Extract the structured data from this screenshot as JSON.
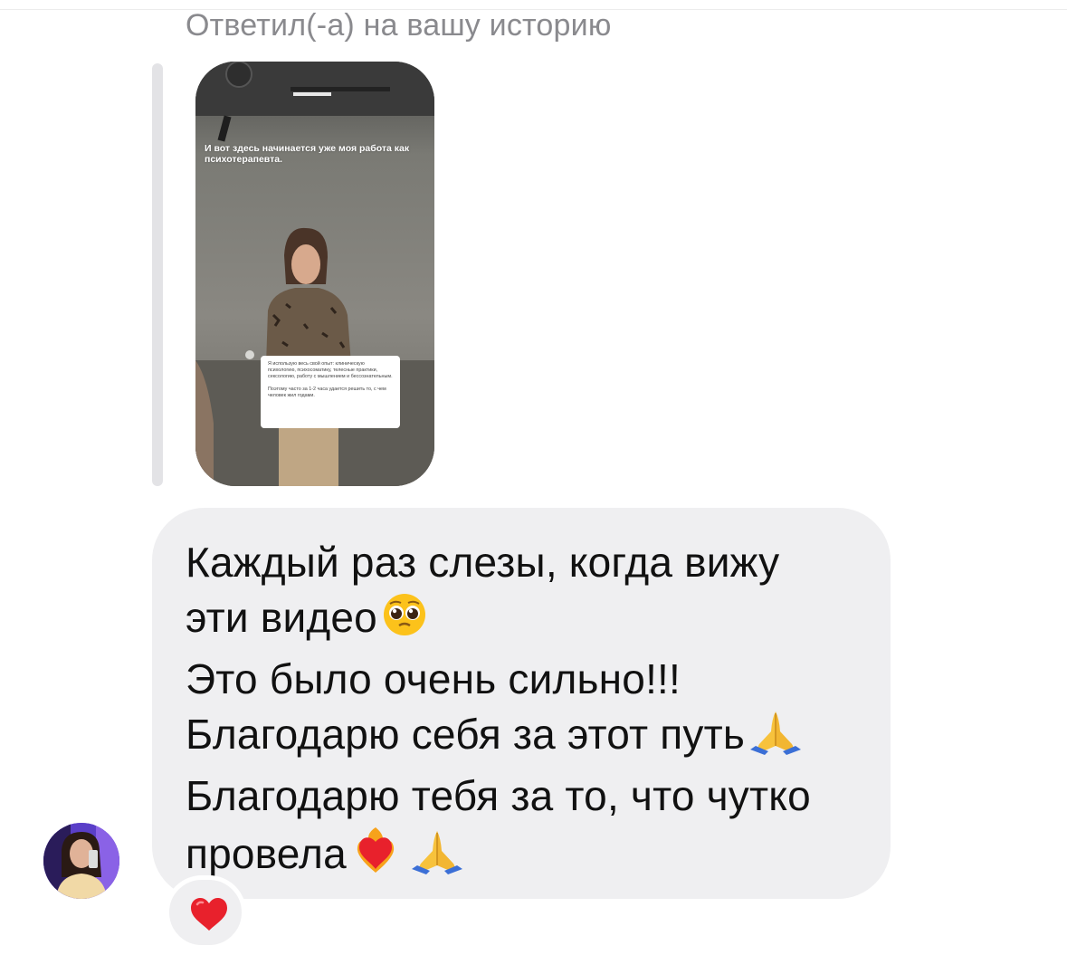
{
  "reply": {
    "caption": "Ответил(-а) на вашу историю"
  },
  "story": {
    "headline": "И вот здесь начинается уже моя работа как психотерапевта.",
    "note_paragraph_1": "Я использую весь свой опыт: клиническую психологию, психосоматику, телесные практики, сексологию, работу с мышлением и бессознательным.",
    "note_paragraph_2": "Поэтому часто за 1-2 часа удается решить то, с чем человек жил годами."
  },
  "message": {
    "lines": [
      "Каждый раз слезы, когда вижу",
      "эти видео",
      "Это было очень сильно!!!",
      "Благодарю себя за этот путь",
      "Благодарю тебя за то, что чутко",
      "провела"
    ],
    "emojis": [
      "pleading-face",
      "folded-hands",
      "heart-on-fire",
      "folded-hands"
    ]
  },
  "reaction": {
    "emoji": "red-heart"
  },
  "colors": {
    "bubble": "#efeff1",
    "caption": "#8a8a8e",
    "heart": "#e8212c"
  }
}
